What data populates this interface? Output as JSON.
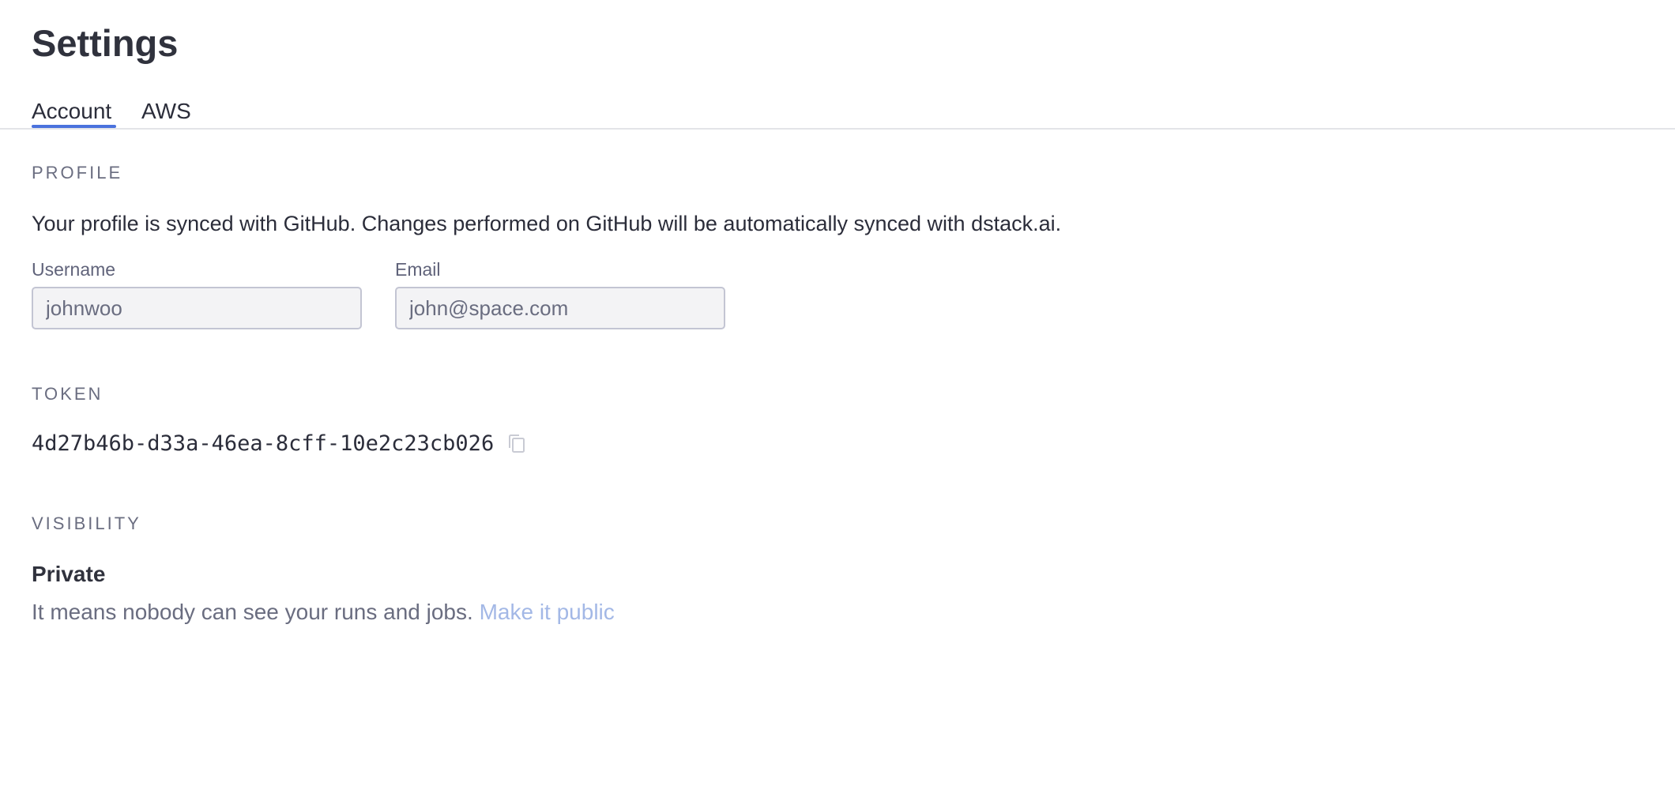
{
  "page": {
    "title": "Settings"
  },
  "tabs": [
    {
      "label": "Account",
      "active": true
    },
    {
      "label": "AWS",
      "active": false
    }
  ],
  "profile": {
    "section_label": "PROFILE",
    "description": "Your profile is synced with GitHub. Changes performed on GitHub will be automatically synced with dstack.ai.",
    "username_label": "Username",
    "username_value": "johnwoo",
    "email_label": "Email",
    "email_value": "john@space.com"
  },
  "token": {
    "section_label": "TOKEN",
    "value": "4d27b46b-d33a-46ea-8cff-10e2c23cb026",
    "copy_icon": "copy-icon"
  },
  "visibility": {
    "section_label": "VISIBILITY",
    "status": "Private",
    "description": "It means nobody can see your runs and jobs.",
    "action_link": "Make it public"
  },
  "colors": {
    "accent": "#4b72dd",
    "link": "#a3b8e6",
    "muted_text": "#6a6d80",
    "input_bg": "#f3f3f5"
  }
}
